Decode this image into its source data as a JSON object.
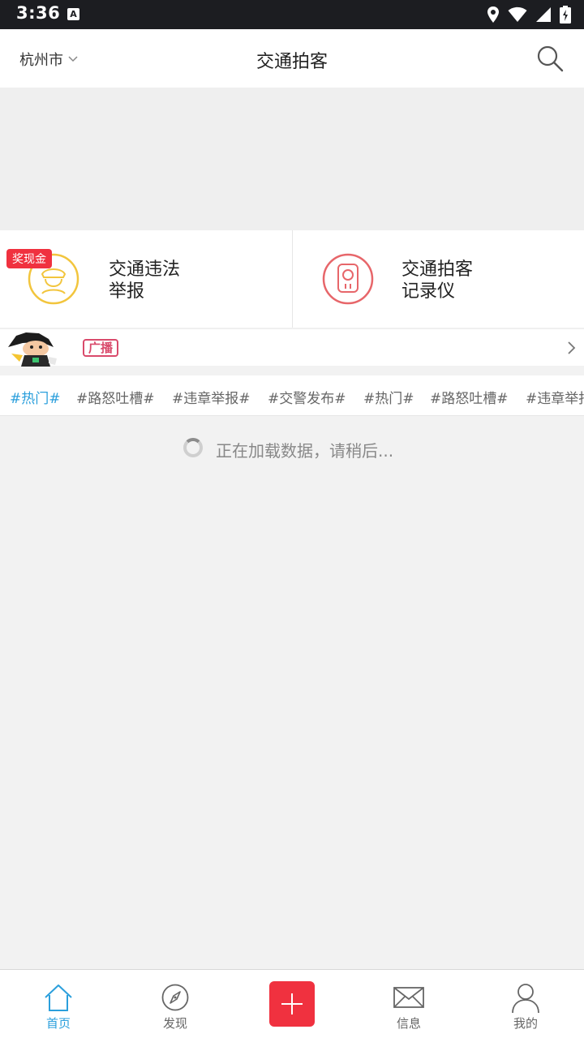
{
  "status_bar": {
    "time": "3:36",
    "notification_icon": "A"
  },
  "header": {
    "city": "杭州市",
    "title": "交通拍客"
  },
  "features": [
    {
      "label_line1": "交通违法",
      "label_line2": "举报",
      "badge": "奖现金",
      "icon": "police-icon",
      "color": "#f2c53d"
    },
    {
      "label_line1": "交通拍客",
      "label_line2": "记录仪",
      "icon": "recorder-icon",
      "color": "#e7666a"
    }
  ],
  "broadcast": {
    "tag": "广播"
  },
  "tags": [
    {
      "label": "#热门#",
      "active": true
    },
    {
      "label": "#路怒吐槽#"
    },
    {
      "label": "#违章举报#"
    },
    {
      "label": "#交警发布#"
    },
    {
      "label": "#热门#"
    },
    {
      "label": "#路怒吐槽#"
    },
    {
      "label": "#违章举报#"
    }
  ],
  "loading": {
    "text": "正在加载数据，请稍后..."
  },
  "bottom_nav": {
    "home": "首页",
    "discover": "发现",
    "messages": "信息",
    "mine": "我的"
  },
  "colors": {
    "accent_blue": "#2b9fdc",
    "accent_red": "#f0313f"
  }
}
